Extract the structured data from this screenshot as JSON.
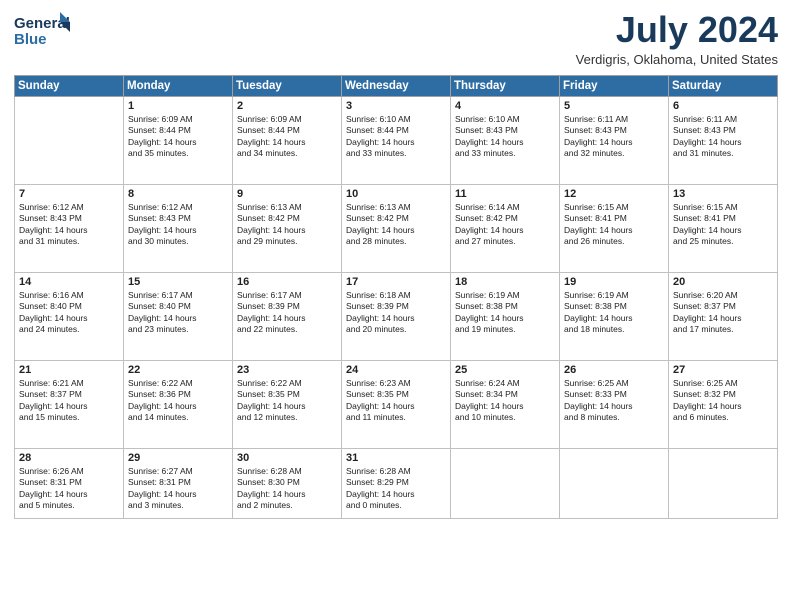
{
  "header": {
    "logo_line1": "General",
    "logo_line2": "Blue",
    "month": "July 2024",
    "location": "Verdigris, Oklahoma, United States"
  },
  "weekdays": [
    "Sunday",
    "Monday",
    "Tuesday",
    "Wednesday",
    "Thursday",
    "Friday",
    "Saturday"
  ],
  "weeks": [
    [
      {
        "day": "",
        "info": ""
      },
      {
        "day": "1",
        "info": "Sunrise: 6:09 AM\nSunset: 8:44 PM\nDaylight: 14 hours\nand 35 minutes."
      },
      {
        "day": "2",
        "info": "Sunrise: 6:09 AM\nSunset: 8:44 PM\nDaylight: 14 hours\nand 34 minutes."
      },
      {
        "day": "3",
        "info": "Sunrise: 6:10 AM\nSunset: 8:44 PM\nDaylight: 14 hours\nand 33 minutes."
      },
      {
        "day": "4",
        "info": "Sunrise: 6:10 AM\nSunset: 8:43 PM\nDaylight: 14 hours\nand 33 minutes."
      },
      {
        "day": "5",
        "info": "Sunrise: 6:11 AM\nSunset: 8:43 PM\nDaylight: 14 hours\nand 32 minutes."
      },
      {
        "day": "6",
        "info": "Sunrise: 6:11 AM\nSunset: 8:43 PM\nDaylight: 14 hours\nand 31 minutes."
      }
    ],
    [
      {
        "day": "7",
        "info": "Sunrise: 6:12 AM\nSunset: 8:43 PM\nDaylight: 14 hours\nand 31 minutes."
      },
      {
        "day": "8",
        "info": "Sunrise: 6:12 AM\nSunset: 8:43 PM\nDaylight: 14 hours\nand 30 minutes."
      },
      {
        "day": "9",
        "info": "Sunrise: 6:13 AM\nSunset: 8:42 PM\nDaylight: 14 hours\nand 29 minutes."
      },
      {
        "day": "10",
        "info": "Sunrise: 6:13 AM\nSunset: 8:42 PM\nDaylight: 14 hours\nand 28 minutes."
      },
      {
        "day": "11",
        "info": "Sunrise: 6:14 AM\nSunset: 8:42 PM\nDaylight: 14 hours\nand 27 minutes."
      },
      {
        "day": "12",
        "info": "Sunrise: 6:15 AM\nSunset: 8:41 PM\nDaylight: 14 hours\nand 26 minutes."
      },
      {
        "day": "13",
        "info": "Sunrise: 6:15 AM\nSunset: 8:41 PM\nDaylight: 14 hours\nand 25 minutes."
      }
    ],
    [
      {
        "day": "14",
        "info": "Sunrise: 6:16 AM\nSunset: 8:40 PM\nDaylight: 14 hours\nand 24 minutes."
      },
      {
        "day": "15",
        "info": "Sunrise: 6:17 AM\nSunset: 8:40 PM\nDaylight: 14 hours\nand 23 minutes."
      },
      {
        "day": "16",
        "info": "Sunrise: 6:17 AM\nSunset: 8:39 PM\nDaylight: 14 hours\nand 22 minutes."
      },
      {
        "day": "17",
        "info": "Sunrise: 6:18 AM\nSunset: 8:39 PM\nDaylight: 14 hours\nand 20 minutes."
      },
      {
        "day": "18",
        "info": "Sunrise: 6:19 AM\nSunset: 8:38 PM\nDaylight: 14 hours\nand 19 minutes."
      },
      {
        "day": "19",
        "info": "Sunrise: 6:19 AM\nSunset: 8:38 PM\nDaylight: 14 hours\nand 18 minutes."
      },
      {
        "day": "20",
        "info": "Sunrise: 6:20 AM\nSunset: 8:37 PM\nDaylight: 14 hours\nand 17 minutes."
      }
    ],
    [
      {
        "day": "21",
        "info": "Sunrise: 6:21 AM\nSunset: 8:37 PM\nDaylight: 14 hours\nand 15 minutes."
      },
      {
        "day": "22",
        "info": "Sunrise: 6:22 AM\nSunset: 8:36 PM\nDaylight: 14 hours\nand 14 minutes."
      },
      {
        "day": "23",
        "info": "Sunrise: 6:22 AM\nSunset: 8:35 PM\nDaylight: 14 hours\nand 12 minutes."
      },
      {
        "day": "24",
        "info": "Sunrise: 6:23 AM\nSunset: 8:35 PM\nDaylight: 14 hours\nand 11 minutes."
      },
      {
        "day": "25",
        "info": "Sunrise: 6:24 AM\nSunset: 8:34 PM\nDaylight: 14 hours\nand 10 minutes."
      },
      {
        "day": "26",
        "info": "Sunrise: 6:25 AM\nSunset: 8:33 PM\nDaylight: 14 hours\nand 8 minutes."
      },
      {
        "day": "27",
        "info": "Sunrise: 6:25 AM\nSunset: 8:32 PM\nDaylight: 14 hours\nand 6 minutes."
      }
    ],
    [
      {
        "day": "28",
        "info": "Sunrise: 6:26 AM\nSunset: 8:31 PM\nDaylight: 14 hours\nand 5 minutes."
      },
      {
        "day": "29",
        "info": "Sunrise: 6:27 AM\nSunset: 8:31 PM\nDaylight: 14 hours\nand 3 minutes."
      },
      {
        "day": "30",
        "info": "Sunrise: 6:28 AM\nSunset: 8:30 PM\nDaylight: 14 hours\nand 2 minutes."
      },
      {
        "day": "31",
        "info": "Sunrise: 6:28 AM\nSunset: 8:29 PM\nDaylight: 14 hours\nand 0 minutes."
      },
      {
        "day": "",
        "info": ""
      },
      {
        "day": "",
        "info": ""
      },
      {
        "day": "",
        "info": ""
      }
    ]
  ]
}
